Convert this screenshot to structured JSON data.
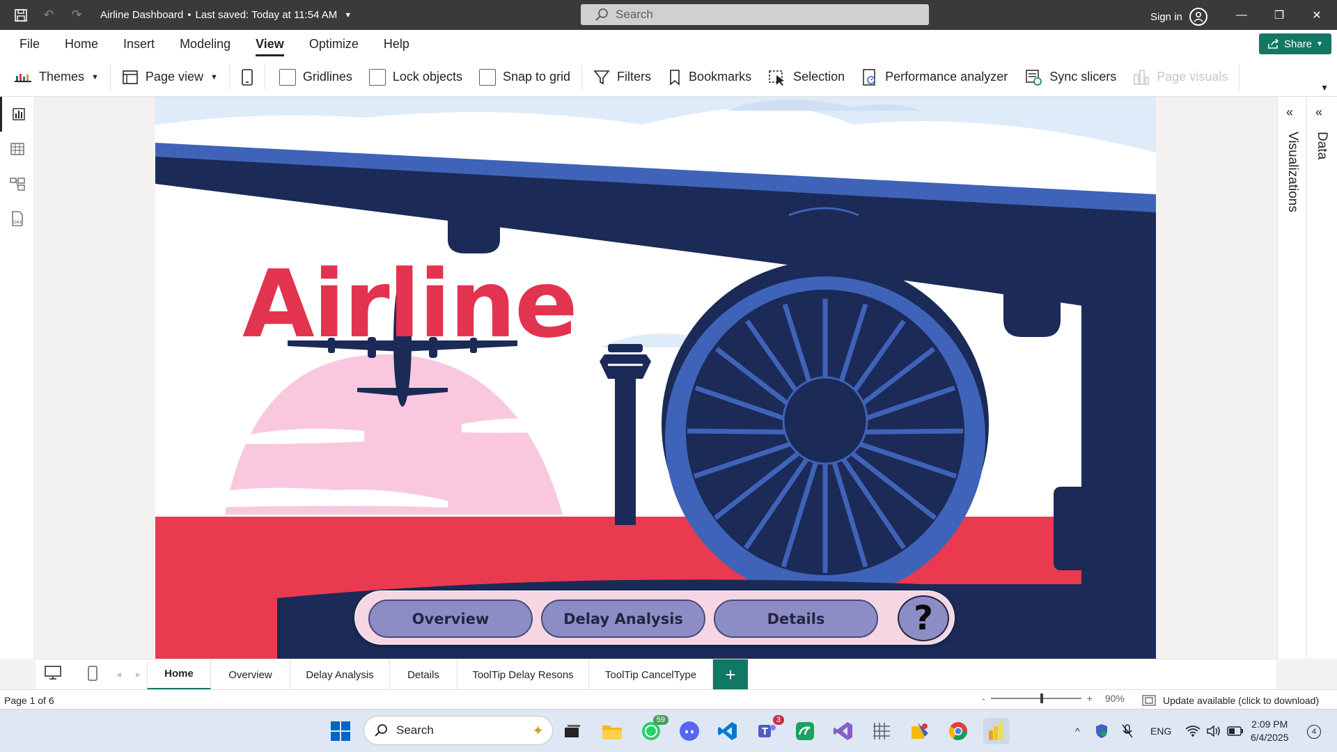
{
  "titlebar": {
    "doc_title": "Airline Dashboard",
    "saved_status": "Last saved: Today at 11:54 AM",
    "search_placeholder": "Search",
    "sign_in": "Sign in"
  },
  "menu": [
    "File",
    "Home",
    "Insert",
    "Modeling",
    "View",
    "Optimize",
    "Help"
  ],
  "menu_active": "View",
  "share_label": "Share",
  "ribbon": {
    "themes": "Themes",
    "page_view": "Page view",
    "gridlines": "Gridlines",
    "lock_objects": "Lock objects",
    "snap_to_grid": "Snap to grid",
    "filters": "Filters",
    "bookmarks": "Bookmarks",
    "selection": "Selection",
    "performance_analyzer": "Performance analyzer",
    "sync_slicers": "Sync slicers",
    "page_visuals": "Page visuals"
  },
  "report": {
    "title": "Airline",
    "nav_buttons": [
      "Overview",
      "Delay Analysis",
      "Details"
    ],
    "help_symbol": "?"
  },
  "panes": {
    "visualizations": "Visualizations",
    "data": "Data"
  },
  "page_tabs": [
    "Home",
    "Overview",
    "Delay Analysis",
    "Details",
    "ToolTip Delay Resons",
    "ToolTip CancelType"
  ],
  "active_tab": "Home",
  "add_tab": "+",
  "status": {
    "page": "Page 1 of 6",
    "zoom_minus": "-",
    "zoom_plus": "+",
    "zoom": "90%",
    "zoom_level": 0.9,
    "update": "Update available (click to download)"
  },
  "taskbar": {
    "search": "Search",
    "whatsapp_badge": "59",
    "teams_badge": "3",
    "lang": "ENG",
    "time": "2:09 PM",
    "date": "6/4/2025",
    "notifications": "4"
  },
  "colors": {
    "brand_teal": "#117865",
    "title_red": "#e2334f",
    "navy": "#1b2a57",
    "blue": "#3f63b8",
    "nav_button": "#8d8dc6"
  }
}
